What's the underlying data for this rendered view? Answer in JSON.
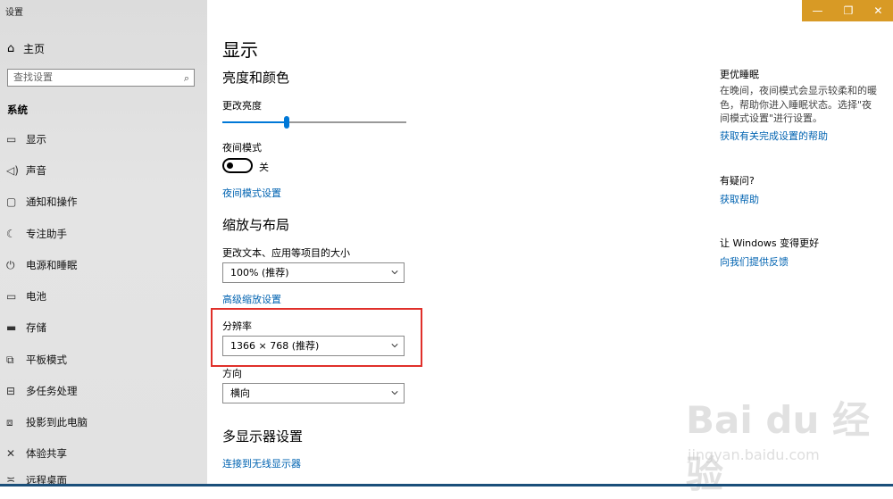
{
  "window": {
    "title": "设置"
  },
  "sidebar": {
    "home_label": "主页",
    "search_placeholder": "查找设置",
    "section": "系统",
    "items": [
      {
        "label": "显示",
        "icon": "monitor-icon"
      },
      {
        "label": "声音",
        "icon": "speaker-icon"
      },
      {
        "label": "通知和操作",
        "icon": "notification-icon"
      },
      {
        "label": "专注助手",
        "icon": "moon-icon"
      },
      {
        "label": "电源和睡眠",
        "icon": "power-icon"
      },
      {
        "label": "电池",
        "icon": "battery-icon"
      },
      {
        "label": "存储",
        "icon": "storage-icon"
      },
      {
        "label": "平板模式",
        "icon": "tablet-icon"
      },
      {
        "label": "多任务处理",
        "icon": "multitask-icon"
      },
      {
        "label": "投影到此电脑",
        "icon": "project-icon"
      },
      {
        "label": "体验共享",
        "icon": "share-icon"
      },
      {
        "label": "远程桌面",
        "icon": "remote-icon"
      }
    ]
  },
  "main": {
    "title": "显示",
    "brightness": {
      "heading": "亮度和颜色",
      "label": "更改亮度",
      "value_fraction": 0.35
    },
    "night_light": {
      "label": "夜间模式",
      "state": "关",
      "settings_link": "夜间模式设置"
    },
    "scale": {
      "heading": "缩放与布局",
      "text_size_label": "更改文本、应用等项目的大小",
      "text_size_value": "100% (推荐)",
      "advanced_link": "高级缩放设置",
      "resolution_label": "分辨率",
      "resolution_value": "1366 × 768 (推荐)",
      "orientation_label": "方向",
      "orientation_value": "横向"
    },
    "multi_display": {
      "heading": "多显示器设置",
      "wireless_link": "连接到无线显示器"
    }
  },
  "right": {
    "sleep_heading": "更优睡眠",
    "sleep_text": "在晚间，夜间模式会显示较柔和的暖色，帮助你进入睡眠状态。选择\"夜间模式设置\"进行设置。",
    "sleep_link": "获取有关完成设置的帮助",
    "question_heading": "有疑问?",
    "question_link": "获取帮助",
    "improve_heading": "让 Windows 变得更好",
    "improve_link": "向我们提供反馈"
  },
  "colors": {
    "accent": "#0078d7",
    "link": "#0063b1",
    "highlight": "#e0302a",
    "titlebar": "#d89a25"
  },
  "watermark": {
    "main": "Bai du 经验",
    "sub": "jingyan.baidu.com"
  }
}
